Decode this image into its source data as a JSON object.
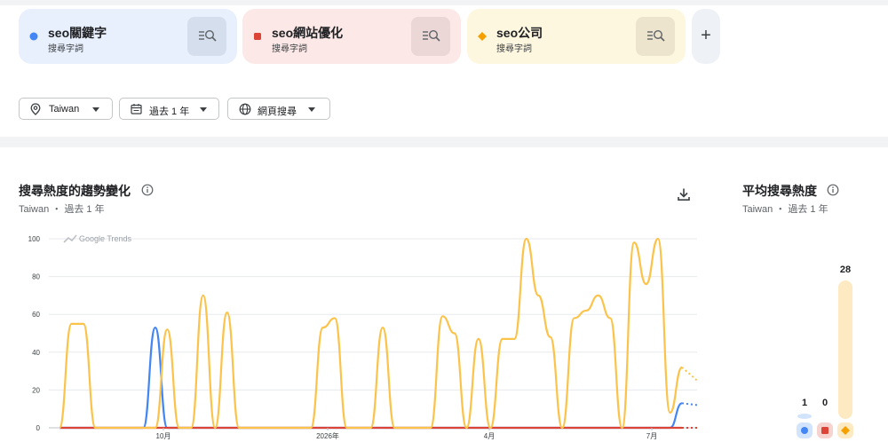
{
  "terms": [
    {
      "name": "seo關鍵字",
      "subtitle": "搜尋字詞",
      "color": "#4285f4",
      "marker": "circle"
    },
    {
      "name": "seo網站優化",
      "subtitle": "搜尋字詞",
      "color": "#db4437",
      "marker": "square"
    },
    {
      "name": "seo公司",
      "subtitle": "搜尋字詞",
      "color": "#f4b400",
      "marker": "diamond"
    }
  ],
  "add_button": {
    "label": "+"
  },
  "filters": {
    "region": "Taiwan",
    "period": "過去 1 年",
    "search_type": "網頁搜尋"
  },
  "trend_section": {
    "title": "搜尋熱度的趨勢變化",
    "subtitle": "Taiwan ・ 過去 1 年",
    "watermark": "Google Trends"
  },
  "average_section": {
    "title": "平均搜尋熱度",
    "subtitle": "Taiwan ・ 過去 1 年"
  },
  "chart_data": [
    {
      "type": "line",
      "title": "搜尋熱度的趨勢變化",
      "ylim": [
        0,
        100
      ],
      "y_ticks": [
        0,
        20,
        40,
        60,
        80,
        100
      ],
      "x_ticks": [
        "10月",
        "2026年",
        "4月",
        "7月"
      ],
      "grid": true,
      "series": [
        {
          "name": "seo關鍵字",
          "color": "#4285f4",
          "values": [
            0,
            0,
            0,
            0,
            0,
            0,
            0,
            0,
            53,
            0,
            0,
            0,
            0,
            0,
            0,
            0,
            0,
            0,
            0,
            0,
            0,
            0,
            0,
            0,
            0,
            0,
            0,
            0,
            0,
            0,
            0,
            0,
            0,
            0,
            0,
            0,
            0,
            0,
            0,
            0,
            0,
            0,
            0,
            0,
            0,
            0,
            0,
            0,
            0,
            0,
            0,
            0,
            13
          ],
          "partial_values": [
            13,
            12
          ]
        },
        {
          "name": "seo網站優化",
          "color": "#db4437",
          "values": [
            0,
            0,
            0,
            0,
            0,
            0,
            0,
            0,
            0,
            0,
            0,
            0,
            0,
            0,
            0,
            0,
            0,
            0,
            0,
            0,
            0,
            0,
            0,
            0,
            0,
            0,
            0,
            0,
            0,
            0,
            0,
            0,
            0,
            0,
            0,
            0,
            0,
            0,
            0,
            0,
            0,
            0,
            0,
            0,
            0,
            0,
            0,
            0,
            0,
            0,
            0,
            0,
            0
          ],
          "partial_values": [
            0,
            0
          ]
        },
        {
          "name": "seo公司",
          "color": "#fbc34a",
          "values": [
            0,
            55,
            55,
            0,
            0,
            0,
            0,
            0,
            0,
            52,
            0,
            0,
            70,
            0,
            61,
            0,
            0,
            0,
            0,
            0,
            0,
            0,
            53,
            58,
            0,
            0,
            0,
            53,
            0,
            0,
            0,
            0,
            59,
            50,
            0,
            47,
            0,
            47,
            47,
            100,
            70,
            48,
            0,
            58,
            62,
            70,
            58,
            0,
            98,
            76,
            100,
            8,
            32
          ],
          "partial_values": [
            32,
            25
          ]
        }
      ]
    },
    {
      "type": "bar",
      "title": "平均搜尋熱度",
      "categories": [
        "seo關鍵字",
        "seo網站優化",
        "seo公司"
      ],
      "values": [
        1,
        0,
        28
      ],
      "data_labels": [
        "1",
        "0",
        "28"
      ],
      "colors": [
        "#4285f4",
        "#db4437",
        "#f4b400"
      ]
    }
  ]
}
